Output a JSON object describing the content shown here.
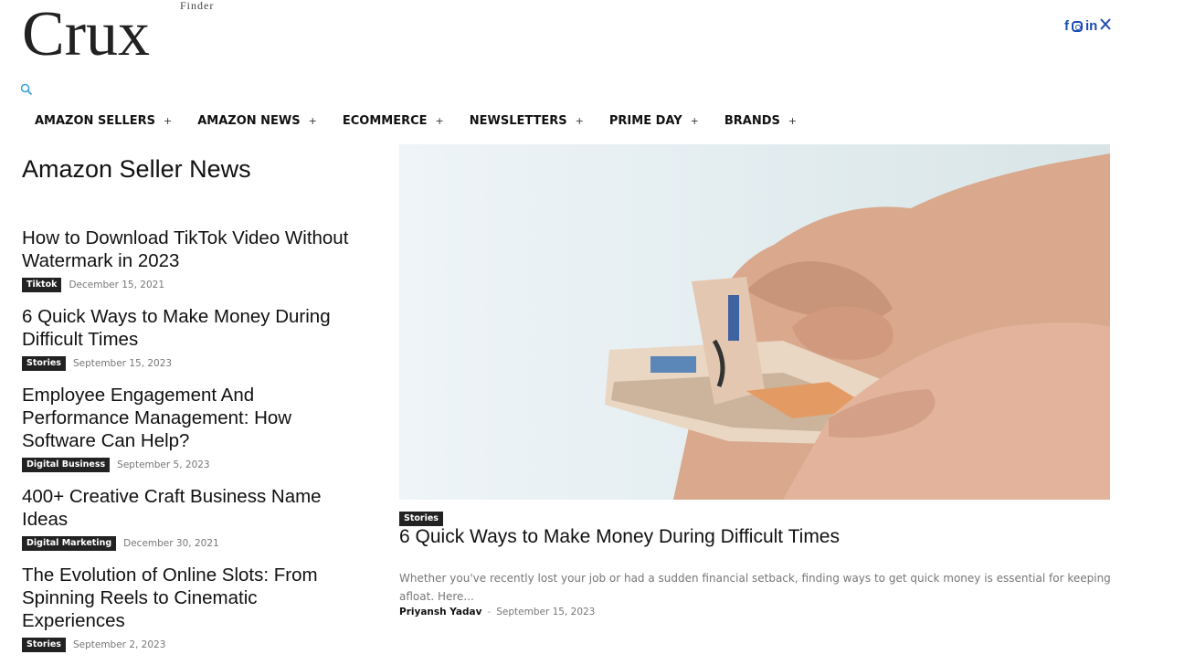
{
  "site": {
    "logo": "Crux",
    "logo_sub": "Finder"
  },
  "header": {
    "socials": [
      "facebook-icon",
      "instagram-icon",
      "linkedin-icon",
      "x-icon"
    ],
    "social_glyphs": {
      "facebook": "f",
      "linkedin": "in",
      "x": "𝕏"
    },
    "brand_color": "#1a4db3",
    "search_icon": "search-icon"
  },
  "nav": {
    "items": [
      {
        "label": "AMAZON SELLERS"
      },
      {
        "label": "AMAZON NEWS"
      },
      {
        "label": "ECOMMERCE"
      },
      {
        "label": "NEWSLETTERS"
      },
      {
        "label": "PRIME DAY"
      },
      {
        "label": "BRANDS"
      }
    ],
    "expand_symbol": "+"
  },
  "section": {
    "title": "Amazon Seller News"
  },
  "articles": [
    {
      "title": "How to Download TikTok Video Without Watermark in 2023",
      "category": "Tiktok",
      "date": "December 15, 2021"
    },
    {
      "title": "6 Quick Ways to Make Money During Difficult Times",
      "category": "Stories",
      "date": "September 15, 2023"
    },
    {
      "title": "Employee Engagement And Performance Management: How Software Can Help?",
      "category": "Digital Business",
      "date": "September 5, 2023"
    },
    {
      "title": "400+ Creative Craft Business Name Ideas",
      "category": "Digital Marketing",
      "date": "December 30, 2021"
    },
    {
      "title": "The Evolution of Online Slots: From Spinning Reels to Cinematic Experiences",
      "category": "Stories",
      "date": "September 2, 2023"
    }
  ],
  "featured": {
    "category": "Stories",
    "title": "6 Quick Ways to Make Money During Difficult Times",
    "excerpt": "Whether you've recently lost your job or had a sudden financial setback, finding ways to get quick money is essential for keeping afloat. Here...",
    "author": "Priyansh Yadav",
    "separator": "-",
    "date": "September 15, 2023"
  }
}
